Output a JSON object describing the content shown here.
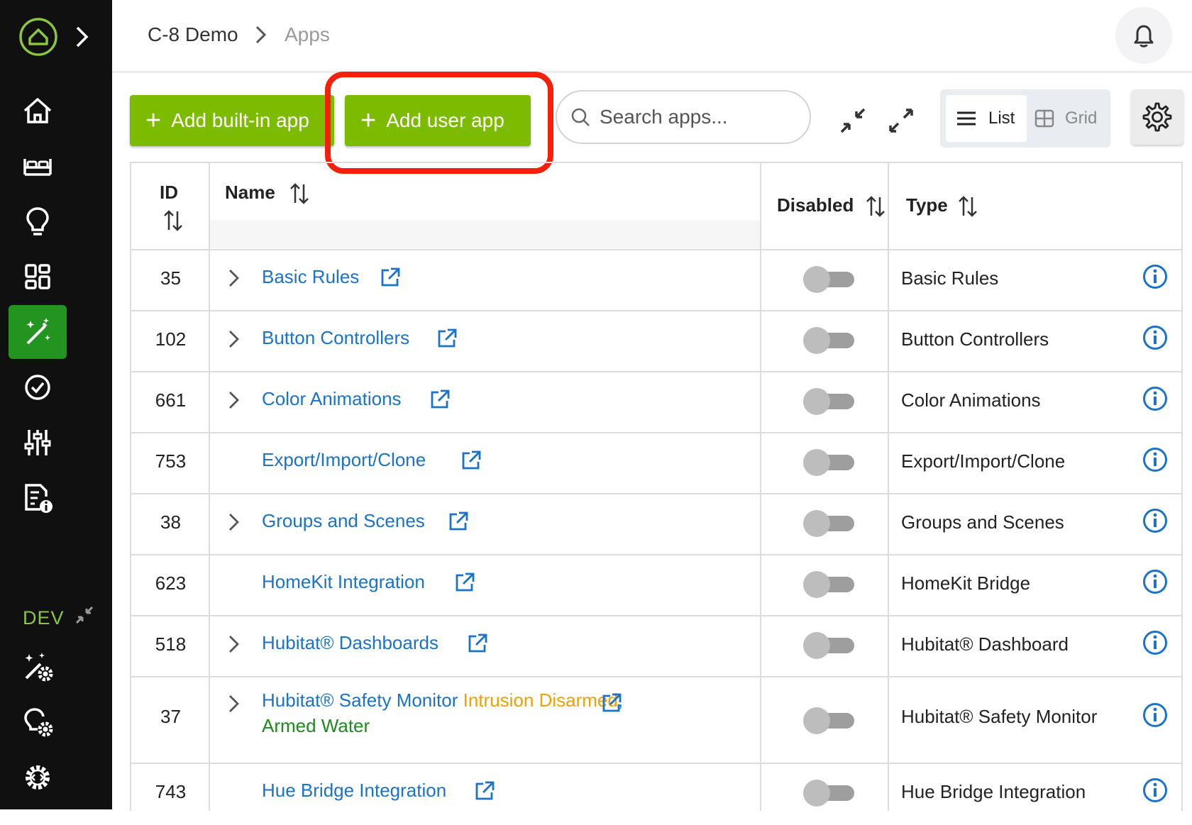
{
  "sidebar": {
    "logo": "hubitat-home-logo",
    "expand_icon": "chevron-right-icon",
    "nav": [
      {
        "icon": "home-icon"
      },
      {
        "icon": "bed-icon"
      },
      {
        "icon": "lightbulb-icon"
      },
      {
        "icon": "dashboard-icon"
      },
      {
        "icon": "magic-wand-icon",
        "active": true
      },
      {
        "icon": "check-circle-icon"
      },
      {
        "icon": "sliders-icon"
      },
      {
        "icon": "logs-info-icon"
      }
    ],
    "dev_label": "DEV",
    "dev_nav": [
      {
        "icon": "wand-gear-icon"
      },
      {
        "icon": "bulb-gear-icon"
      },
      {
        "icon": "code-gear-icon"
      }
    ]
  },
  "header": {
    "breadcrumb_root": "C-8 Demo",
    "breadcrumb_current": "Apps"
  },
  "toolbar": {
    "add_builtin_label": "Add built-in app",
    "add_user_label": "Add user app",
    "search_placeholder": "Search apps...",
    "view_list_label": "List",
    "view_grid_label": "Grid"
  },
  "table": {
    "headers": {
      "id": "ID",
      "name": "Name",
      "disabled": "Disabled",
      "type": "Type"
    },
    "rows": [
      {
        "id": "35",
        "name": "Basic Rules",
        "type": "Basic Rules",
        "expandable": true,
        "disabled": false
      },
      {
        "id": "102",
        "name": "Button Controllers",
        "type": "Button Controllers",
        "expandable": true,
        "disabled": false
      },
      {
        "id": "661",
        "name": "Color Animations",
        "type": "Color Animations",
        "expandable": true,
        "disabled": false
      },
      {
        "id": "753",
        "name": "Export/Import/Clone",
        "type": "Export/Import/Clone",
        "expandable": false,
        "disabled": false
      },
      {
        "id": "38",
        "name": "Groups and Scenes",
        "type": "Groups and Scenes",
        "expandable": true,
        "disabled": false
      },
      {
        "id": "623",
        "name": "HomeKit Integration",
        "type": "HomeKit Bridge",
        "expandable": false,
        "disabled": false
      },
      {
        "id": "518",
        "name": "Hubitat® Dashboards",
        "type": "Hubitat® Dashboard",
        "expandable": true,
        "disabled": false
      },
      {
        "id": "37",
        "name": "Hubitat® Safety Monitor",
        "status_orange": "Intrusion Disarmed",
        "status_sep": ",",
        "status_green": "Armed Water",
        "type": "Hubitat® Safety Monitor",
        "expandable": true,
        "disabled": false
      },
      {
        "id": "743",
        "name": "Hue Bridge Integration",
        "type": "Hue Bridge Integration",
        "expandable": false,
        "disabled": false
      }
    ]
  },
  "colors": {
    "accent_green": "#7cbb00",
    "active_nav": "#22941f",
    "link_blue": "#1a73c8",
    "highlight_red": "#f61f0a"
  }
}
